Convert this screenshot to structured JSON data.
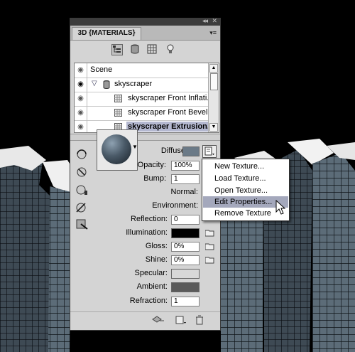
{
  "panel": {
    "tab_label": "3D {MATERIALS}",
    "collapse_glyph": "◂◂",
    "close_glyph": "✕",
    "menu_glyph": "▾≡"
  },
  "filters": [
    {
      "name": "whole-scene-filter",
      "icon": "scene-tree-icon",
      "selected": true
    },
    {
      "name": "meshes-filter",
      "icon": "cylinder-icon",
      "selected": false
    },
    {
      "name": "materials-filter",
      "icon": "grid-icon",
      "selected": false
    },
    {
      "name": "lights-filter",
      "icon": "lightbulb-icon",
      "selected": false
    }
  ],
  "scene": {
    "items": [
      {
        "label": "Scene"
      },
      {
        "label": "skyscraper"
      },
      {
        "label": "skyscraper Front Inflati..."
      },
      {
        "label": "skyscraper Front Bevel ..."
      },
      {
        "label": "skyscraper Extrusion..."
      }
    ]
  },
  "material": {
    "diffuse_label": "Diffuse:",
    "diffuse_color": "#6b7a87",
    "opacity_label": "Opacity:",
    "opacity_value": "100%",
    "bump_label": "Bump:",
    "bump_value": "1",
    "normal_label": "Normal:",
    "environment_label": "Environment:",
    "reflection_label": "Reflection:",
    "reflection_value": "0",
    "illumination_label": "Illumination:",
    "illumination_color": "#000000",
    "gloss_label": "Gloss:",
    "gloss_value": "0%",
    "shine_label": "Shine:",
    "shine_value": "0%",
    "specular_label": "Specular:",
    "specular_color": "#d8d8d8",
    "ambient_label": "Ambient:",
    "ambient_color": "#5a5a5a",
    "refraction_label": "Refraction:",
    "refraction_value": "1"
  },
  "context_menu": {
    "items": [
      {
        "label": "New Texture..."
      },
      {
        "label": "Load Texture..."
      },
      {
        "label": "Open Texture..."
      },
      {
        "label": "Edit Properties...",
        "highlighted": true
      },
      {
        "label": "Remove Texture"
      }
    ]
  },
  "colors": {
    "panel_bg": "#d4d4d4",
    "selection": "#b4b8d0",
    "menu_highlight": "#a4a8bc"
  }
}
